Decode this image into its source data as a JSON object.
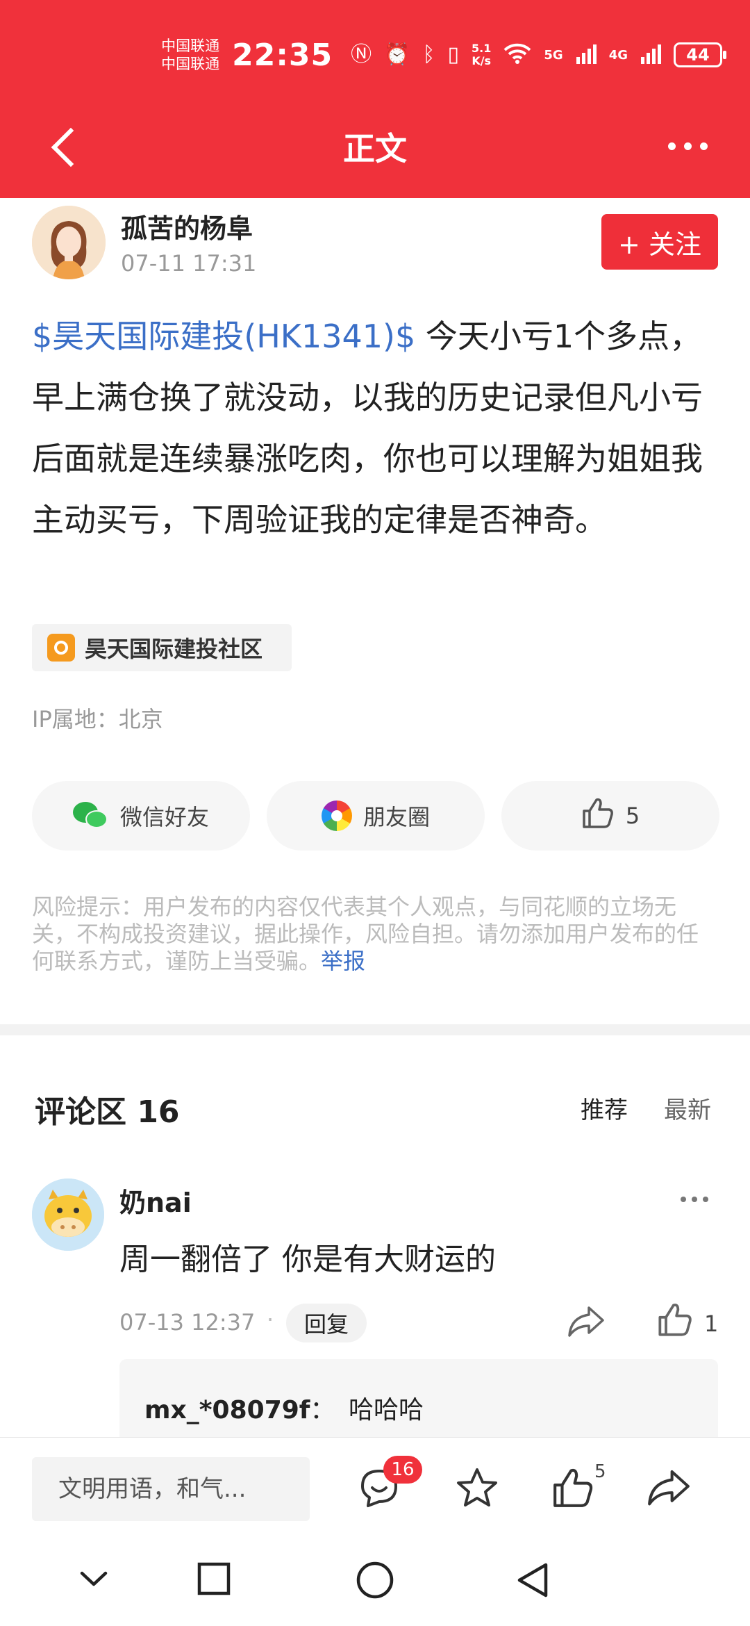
{
  "status_bar": {
    "carrier1": "中国联通",
    "carrier2": "中国联通",
    "time": "22:35",
    "speed_value": "5.1",
    "speed_unit": "K/s",
    "network1": "5G",
    "network2": "4G",
    "battery": "44"
  },
  "header": {
    "title": "正文"
  },
  "author": {
    "name": "孤苦的杨阜",
    "time": "07-11 17:31",
    "follow_label": "+ 关注"
  },
  "post": {
    "stock_link": "$昊天国际建投(HK1341)$",
    "text": " 今天小亏1个多点，早上满仓换了就没动，以我的历史记录但凡小亏后面就是连续暴涨吃肉，你也可以理解为姐姐我主动买亏，下周验证我的定律是否神奇。",
    "community": "昊天国际建投社区",
    "ip_location": "IP属地：北京"
  },
  "share": {
    "wechat_label": "微信好友",
    "moments_label": "朋友圈",
    "like_count": "5"
  },
  "risk": {
    "text": "风险提示：用户发布的内容仅代表其个人观点，与同花顺的立场无关，不构成投资建议，据此操作，风险自担。请勿添加用户发布的任何联系方式，谨防上当受骗。",
    "report_label": "举报"
  },
  "comments": {
    "title": "评论区 16",
    "sort_recommend": "推荐",
    "sort_latest": "最新",
    "items": [
      {
        "user": "奶nai",
        "text": "周一翻倍了 你是有大财运的",
        "time": "07-13 12:37",
        "dot": "·",
        "reply_label": "回复",
        "like_count": "1",
        "replies": [
          {
            "user": "mx_*08079f",
            "separator": "：",
            "text": "哈哈哈"
          }
        ]
      }
    ]
  },
  "bottom_bar": {
    "input_placeholder": "文明用语，和气...",
    "comment_badge": "16",
    "like_count": "5"
  },
  "colors": {
    "brand_red": "#f0313b",
    "link_blue": "#3b6fc7"
  }
}
